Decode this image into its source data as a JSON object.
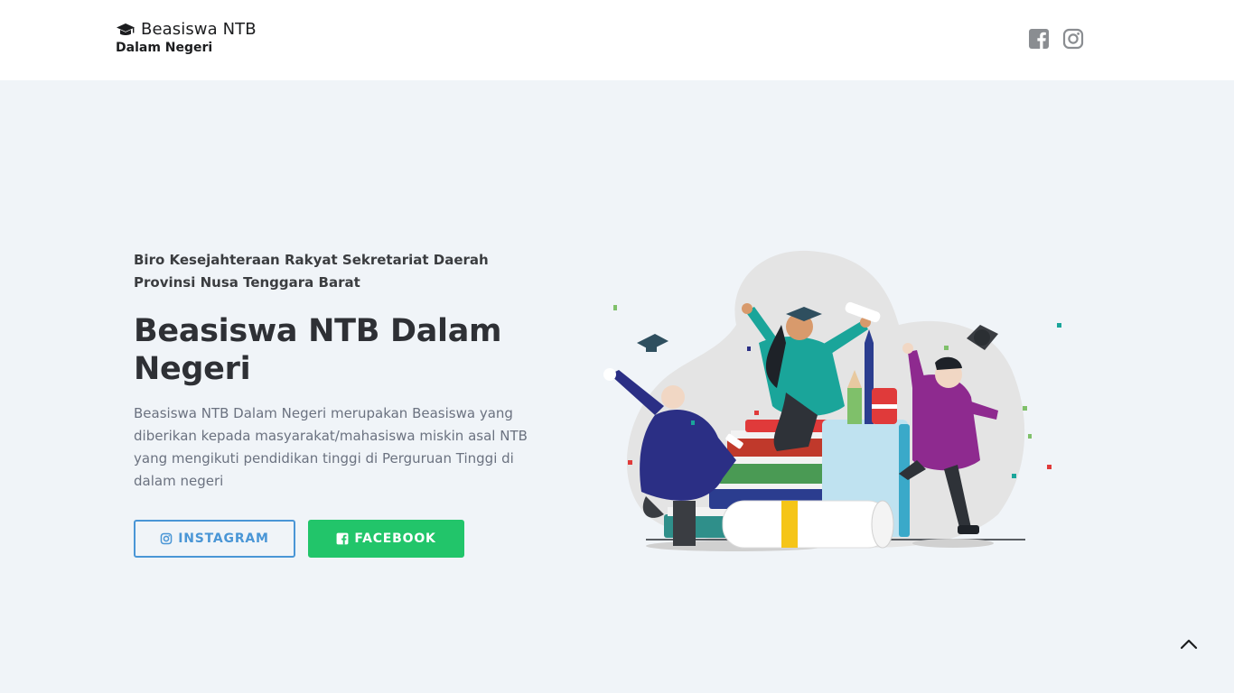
{
  "navbar": {
    "brand_title": "Beasiswa NTB",
    "brand_subtitle": "Dalam Negeri",
    "brand_icon": "graduation-cap-icon",
    "social_icons": [
      "facebook-square-icon",
      "instagram-icon"
    ]
  },
  "hero": {
    "kicker_line1": "Biro Kesejahteraan Rakyat Sekretariat Daerah",
    "kicker_line2": "Provinsi Nusa Tenggara Barat",
    "headline": "Beasiswa NTB Dalam Negeri",
    "description": "Beasiswa NTB Dalam Negeri merupakan Beasiswa yang diberikan kepada masyarakat/mahasiswa miskin asal NTB yang mengikuti pendidikan tinggi di Perguruan Tinggi di dalam negeri",
    "buttons": {
      "instagram": "INSTAGRAM",
      "facebook": "FACEBOOK"
    },
    "illustration": "graduates-celebrating-illustration"
  },
  "colors": {
    "background": "#f0f4f8",
    "instagram_button": "#4a96d6",
    "facebook_button": "#22c56a",
    "headline": "#2e3035"
  },
  "back_to_top_icon": "chevron-up-icon"
}
